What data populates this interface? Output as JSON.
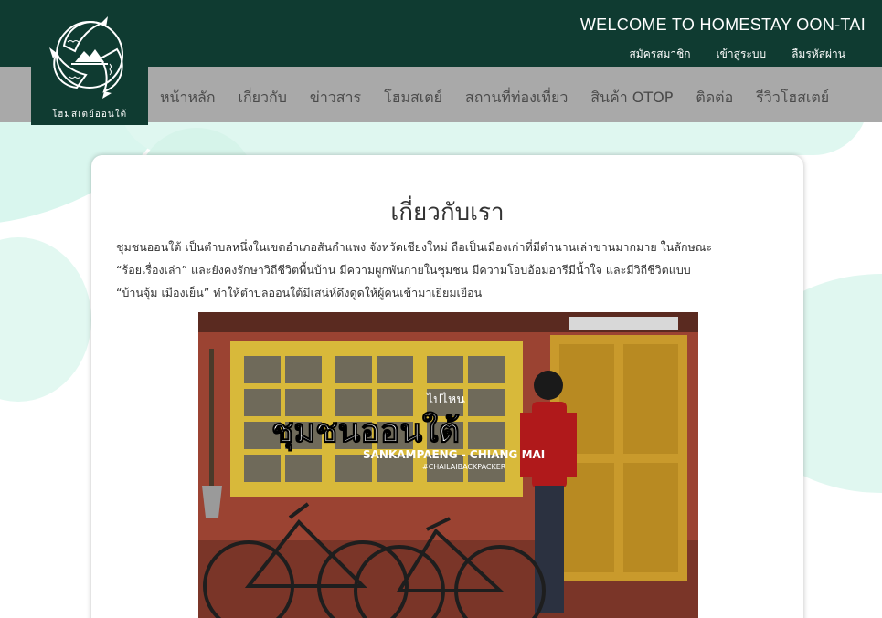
{
  "header": {
    "welcome": "WELCOME TO HOMESTAY OON-TAI",
    "links": {
      "register": "สมัครสมาชิก",
      "login": "เข้าสู่ระบบ",
      "forgot": "ลืมรหัสผ่าน"
    },
    "logo_text": "โฮมสเตย์ออนใต้"
  },
  "nav": {
    "home": "หน้าหลัก",
    "about": "เกี่ยวกับ",
    "news": "ข่าวสาร",
    "homestay": "โฮมสเตย์",
    "attractions": "สถานที่ท่องเที่ยว",
    "otop": "สินค้า OTOP",
    "contact": "ติดต่อ",
    "reviews": "รีวิวโฮสเตย์"
  },
  "content": {
    "title": "เกี่ยวกับเรา",
    "paragraph_line1": "ชุมชนออนใต้ เป็นตำบลหนึ่งในเขตอำเภอสันกำแพง จังหวัดเชียงใหม่ ถือเป็นเมืองเก่าที่มีตำนานเล่าขานมากมาย ในลักษณะ",
    "paragraph_line2": "“ร้อยเรื่องเล่า” และยังคงรักษาวิถีชีวิตพื้นบ้าน มีความผูกพันกายในชุมชน มีความโอบอ้อมอารีมีน้ำใจ และมีวิถีชีวิตแบบ",
    "paragraph_line3": "“บ้านจุ้ม เมืองเย็น” ทำให้ตำบลออนใต้มีเสน่ห์ดึงดูดให้ผู้คนเข้ามาเยี่ยมเยือน"
  },
  "photo": {
    "overlay_small": "ไปไหน",
    "overlay_title": "ชุมชนออนใต้",
    "overlay_sub": "SANKAMPAENG - CHIANG MAI",
    "overlay_tag": "#CHAILAIBACKPACKER"
  },
  "colors": {
    "header_bg": "#0f3b31",
    "nav_bg": "#a9a9a9",
    "mint": "#d9f6ee"
  }
}
